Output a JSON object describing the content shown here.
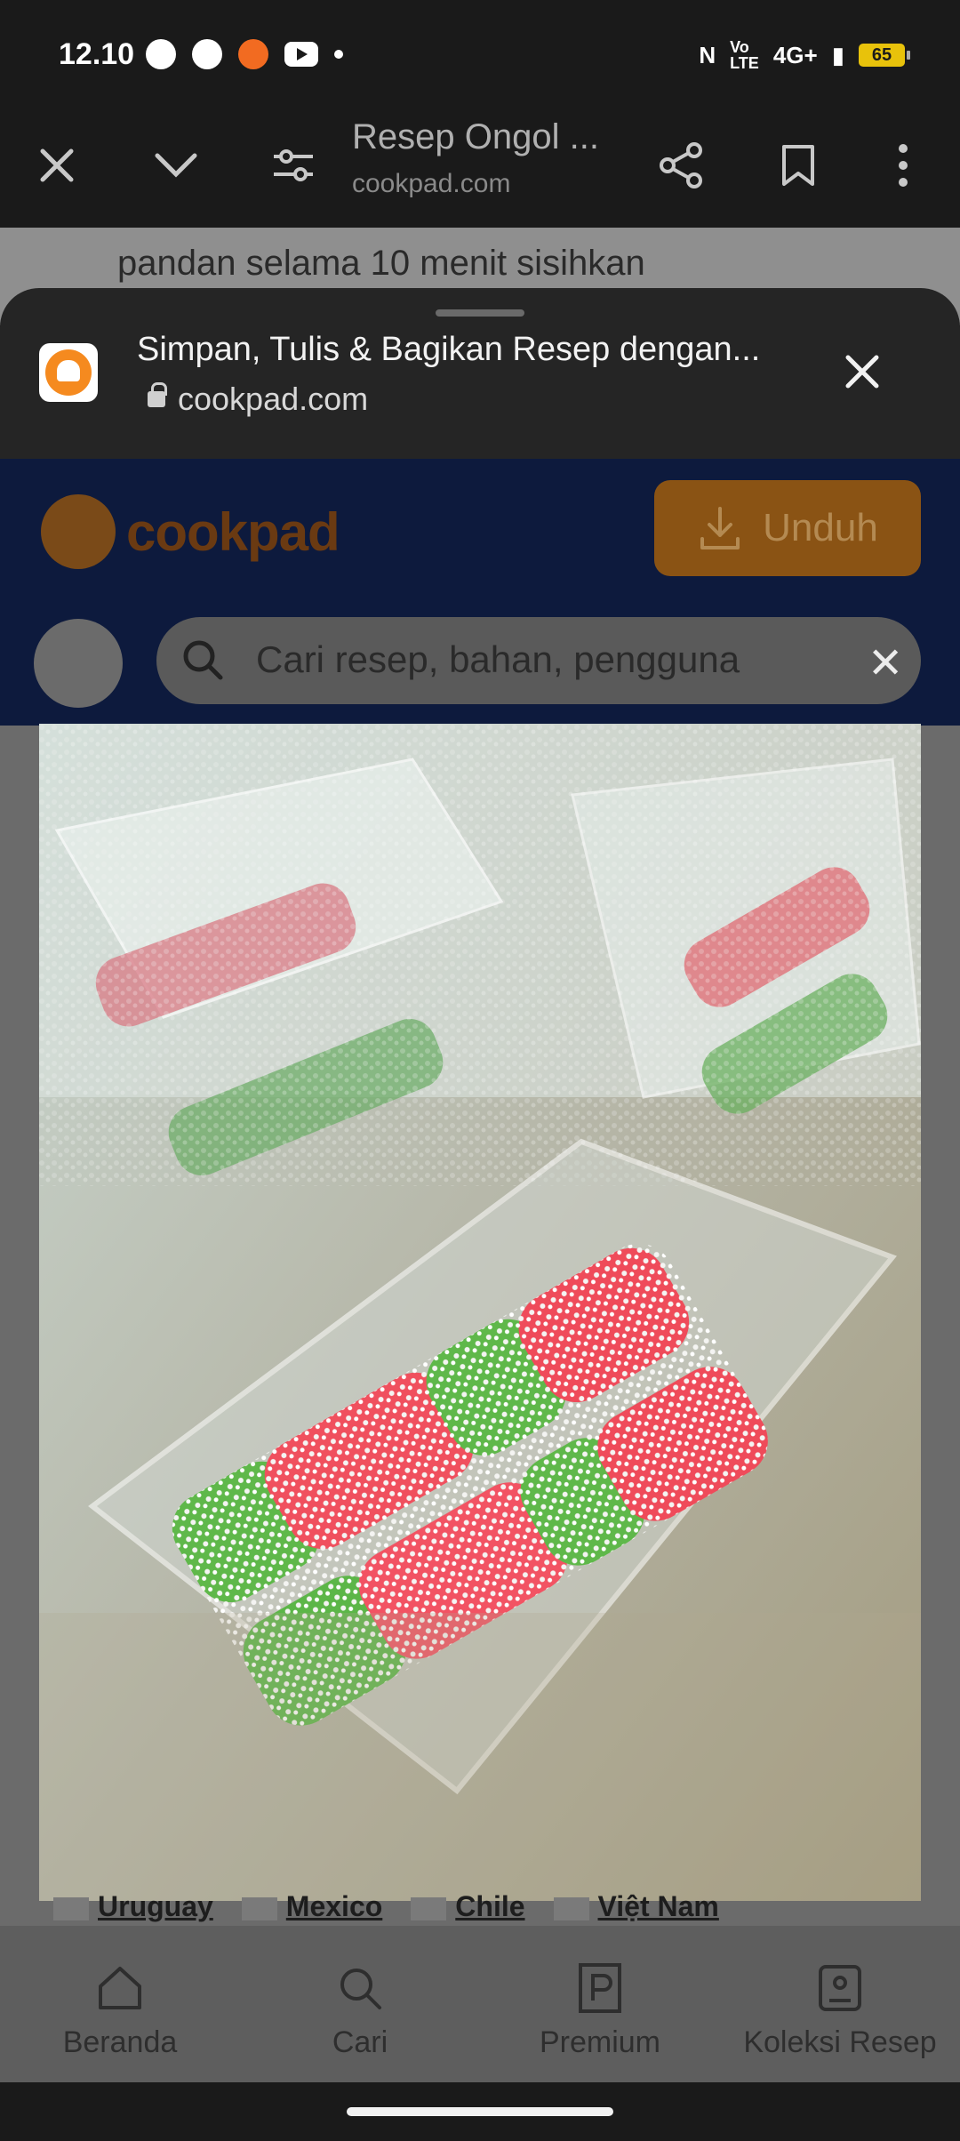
{
  "status_bar": {
    "time": "12.10",
    "network": "4G+",
    "battery": "65"
  },
  "toolbar": {
    "title": "Resep Ongol ...",
    "url": "cookpad.com"
  },
  "page_behind": {
    "text": "pandan selama 10 menit sisihkan"
  },
  "sheet": {
    "title": "Simpan, Tulis & Bagikan Resep dengan...",
    "url": "cookpad.com"
  },
  "site_header": {
    "brand": "cookpad",
    "unduh_label": "Unduh",
    "search_placeholder": "Cari resep, bahan, pengguna"
  },
  "countries": [
    "Uruguay",
    "Mexico",
    "Chile",
    "Việt Nam"
  ],
  "bottom_nav": [
    {
      "label": "Beranda",
      "icon": "home-icon"
    },
    {
      "label": "Cari",
      "icon": "search-icon"
    },
    {
      "label": "Premium",
      "icon": "premium-icon"
    },
    {
      "label": "Koleksi Resep",
      "icon": "collection-icon"
    }
  ],
  "colors": {
    "accent": "#f58a1f",
    "sheet_bg": "#252525",
    "toolbar_bg": "#1a1a1a"
  }
}
